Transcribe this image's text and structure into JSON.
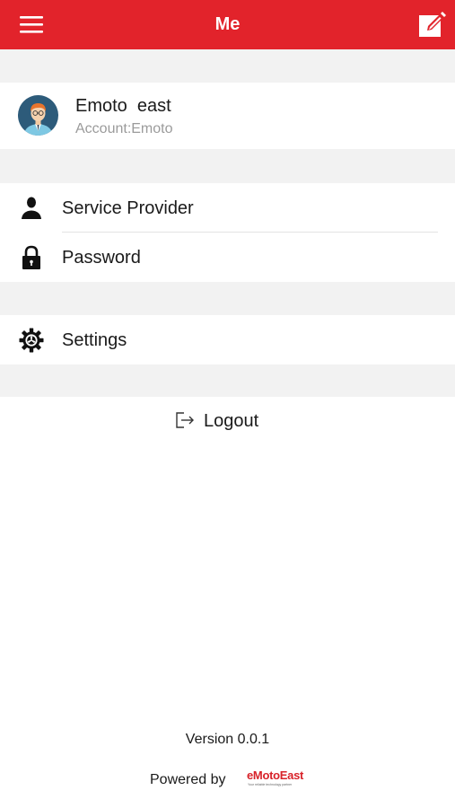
{
  "header": {
    "title": "Me",
    "menu_icon": "hamburger-menu-icon",
    "edit_icon": "edit-icon",
    "background_color": "#e2232b"
  },
  "profile": {
    "name": "Emoto  east",
    "account": "Account:Emoto",
    "avatar_icon": "avatar-icon"
  },
  "menu": {
    "service_provider": {
      "label": "Service Provider",
      "icon": "person-icon"
    },
    "password": {
      "label": "Password",
      "icon": "lock-icon"
    },
    "settings": {
      "label": "Settings",
      "icon": "gear-icon"
    }
  },
  "logout": {
    "label": "Logout",
    "icon": "logout-icon"
  },
  "footer": {
    "version": "Version 0.0.1",
    "powered_by": "Powered by",
    "brand_name": "eMotoEast",
    "brand_tagline": "Your reliable technology partner",
    "brand_color": "#d8232a"
  }
}
